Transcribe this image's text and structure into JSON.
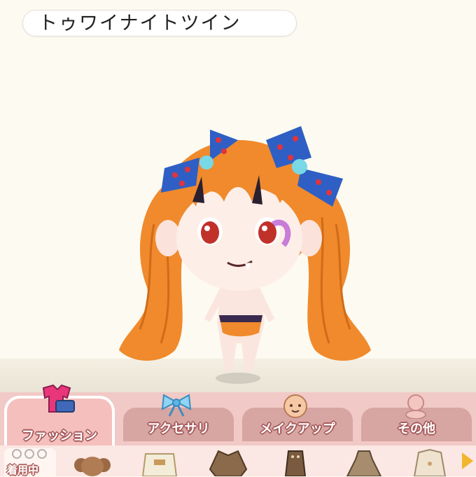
{
  "item_name": "トゥワイナイトツイン",
  "tabs": [
    {
      "label": "ファッション",
      "icon": "clothes-icon",
      "active": true
    },
    {
      "label": "アクセサリ",
      "icon": "ribbon-icon",
      "active": false
    },
    {
      "label": "メイクアップ",
      "icon": "face-icon",
      "active": false
    },
    {
      "label": "その他",
      "icon": "figure-icon",
      "active": false
    }
  ],
  "items_bar": {
    "worn_label": "着用中",
    "items": [
      {
        "icon": "hair-icon"
      },
      {
        "icon": "top-icon"
      },
      {
        "icon": "jacket-icon"
      },
      {
        "icon": "overalls-icon"
      },
      {
        "icon": "dress-icon"
      },
      {
        "icon": "coat-icon"
      }
    ]
  },
  "colors": {
    "background": "#fcfaf1",
    "hair": "#f08a2c",
    "ribbon": "#2f5fc4",
    "tab_active": "#f4bfbd",
    "tab_inactive": "#d7a5a2"
  }
}
